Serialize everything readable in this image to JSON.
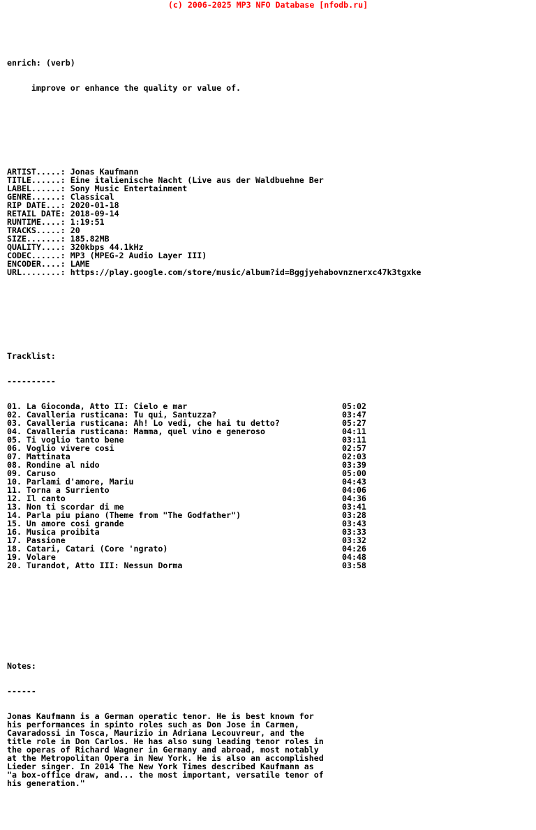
{
  "header": {
    "copyright": "(c) 2006-2025 MP3 NFO Database [nfodb.ru]",
    "color": "#ff0000"
  },
  "word_of_day": {
    "term_line": "enrich: (verb)",
    "definition_line": "     improve or enhance the quality or value of."
  },
  "metadata": {
    "rows": [
      {
        "label": "ARTIST.....:",
        "value": "Jonas Kaufmann"
      },
      {
        "label": "TITLE......:",
        "value": "Eine italienische Nacht (Live aus der Waldbuehne Ber"
      },
      {
        "label": "LABEL......:",
        "value": "Sony Music Entertainment"
      },
      {
        "label": "GENRE......:",
        "value": "Classical"
      },
      {
        "label": "RIP DATE...:",
        "value": "2020-01-18"
      },
      {
        "label": "RETAIL DATE:",
        "value": "2018-09-14"
      },
      {
        "label": "RUNTIME....:",
        "value": "1:19:51"
      },
      {
        "label": "TRACKS.....:",
        "value": "20"
      },
      {
        "label": "SIZE.......:",
        "value": "185.82MB"
      },
      {
        "label": "QUALITY....:",
        "value": "320kbps 44.1kHz"
      },
      {
        "label": "CODEC......:",
        "value": "MP3 (MPEG-2 Audio Layer III)"
      },
      {
        "label": "ENCODER....:",
        "value": "LAME"
      },
      {
        "label": "URL........:",
        "value": "https://play.google.com/store/music/album?id=Bggjyehabovnznerxc47k3tgxke"
      }
    ]
  },
  "tracklist": {
    "heading": "Tracklist:",
    "separator": "----------",
    "tracks": [
      {
        "num": "01.",
        "title": "La Gioconda, Atto II: Cielo e mar",
        "time": "05:02"
      },
      {
        "num": "02.",
        "title": "Cavalleria rusticana: Tu qui, Santuzza?",
        "time": "03:47"
      },
      {
        "num": "03.",
        "title": "Cavalleria rusticana: Ah! Lo vedi, che hai tu detto?",
        "time": "05:27"
      },
      {
        "num": "04.",
        "title": "Cavalleria rusticana: Mamma, quel vino e generoso",
        "time": "04:11"
      },
      {
        "num": "05.",
        "title": "Ti voglio tanto bene",
        "time": "03:11"
      },
      {
        "num": "06.",
        "title": "Voglio vivere cosi",
        "time": "02:57"
      },
      {
        "num": "07.",
        "title": "Mattinata",
        "time": "02:03"
      },
      {
        "num": "08.",
        "title": "Rondine al nido",
        "time": "03:39"
      },
      {
        "num": "09.",
        "title": "Caruso",
        "time": "05:00"
      },
      {
        "num": "10.",
        "title": "Parlami d'amore, Mariu",
        "time": "04:43"
      },
      {
        "num": "11.",
        "title": "Torna a Surriento",
        "time": "04:06"
      },
      {
        "num": "12.",
        "title": "Il canto",
        "time": "04:36"
      },
      {
        "num": "13.",
        "title": "Non ti scordar di me",
        "time": "03:41"
      },
      {
        "num": "14.",
        "title": "Parla piu piano (Theme from \"The Godfather\")",
        "time": "03:28"
      },
      {
        "num": "15.",
        "title": "Un amore cosi grande",
        "time": "03:43"
      },
      {
        "num": "16.",
        "title": "Musica proibita",
        "time": "03:33"
      },
      {
        "num": "17.",
        "title": "Passione",
        "time": "03:32"
      },
      {
        "num": "18.",
        "title": "Catari, Catari (Core 'ngrato)",
        "time": "04:26"
      },
      {
        "num": "19.",
        "title": "Volare",
        "time": "04:48"
      },
      {
        "num": "20.",
        "title": "Turandot, Atto III: Nessun Dorma",
        "time": "03:58"
      }
    ]
  },
  "notes": {
    "heading": "Notes:",
    "separator": "------",
    "lines": [
      "Jonas Kaufmann is a German operatic tenor. He is best known for",
      "his performances in spinto roles such as Don Jose in Carmen,",
      "Cavaradossi in Tosca, Maurizio in Adriana Lecouvreur, and the",
      "title role in Don Carlos. He has also sung leading tenor roles in",
      "the operas of Richard Wagner in Germany and abroad, most notably",
      "at the Metropolitan Opera in New York. He is also an accomplished",
      "Lieder singer. In 2014 The New York Times described Kaufmann as",
      "\"a box-office draw, and... the most important, versatile tenor of",
      "his generation.\""
    ]
  }
}
